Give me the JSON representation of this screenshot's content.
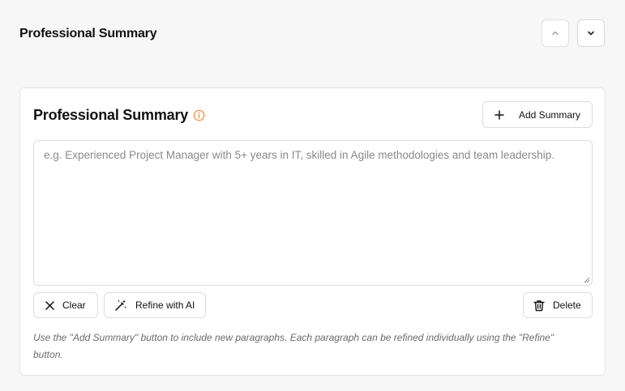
{
  "section": {
    "title": "Professional Summary",
    "move_up_icon": "chevron-up-icon",
    "move_down_icon": "chevron-down-icon"
  },
  "card": {
    "title": "Professional Summary",
    "info_icon": "info-icon",
    "add_button_label": "Add Summary",
    "summary_field": {
      "value": "",
      "placeholder": "e.g. Experienced Project Manager with 5+ years in IT, skilled in Agile methodologies and team leadership."
    },
    "clear_label": "Clear",
    "refine_label": "Refine with AI",
    "delete_label": "Delete",
    "help_text": "Use the \"Add Summary\" button to include new paragraphs. Each paragraph can be refined individually using the \"Refine\" button."
  },
  "colors": {
    "accent": "#f08a24",
    "background": "#f7f7f7",
    "border": "#dcdcdc"
  }
}
